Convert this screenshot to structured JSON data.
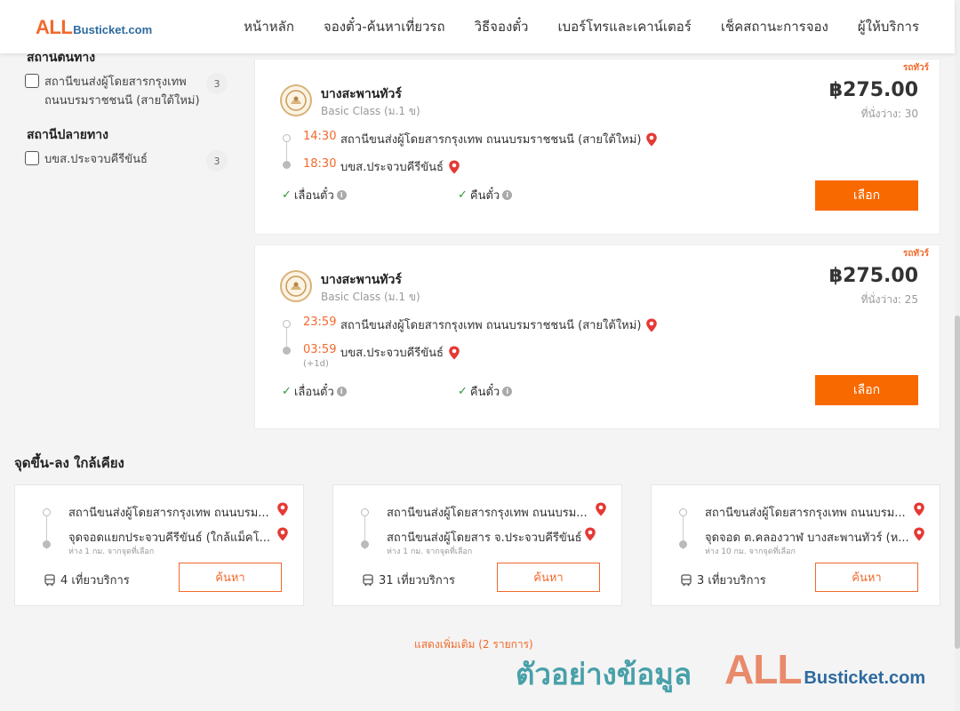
{
  "brand": {
    "logo_all": "ALL",
    "logo_rest": "Busticket.com"
  },
  "nav": [
    "หน้าหลัก",
    "จองตั๋ว-ค้นหาเที่ยวรถ",
    "วิธีจองตั๋ว",
    "เบอร์โทรและเคาน์เตอร์",
    "เช็คสถานะการจอง",
    "ผู้ให้บริการ"
  ],
  "filters": {
    "origin_heading": "สถานีต้นทาง",
    "origin_option": "สถานีขนส่งผู้โดยสารกรุงเทพ ถนนบรมราชชนนี (สายใต้ใหม่)",
    "origin_count": "3",
    "dest_heading": "สถานีปลายทาง",
    "dest_option": "บขส.ประจวบคีรีขันธ์",
    "dest_count": "3"
  },
  "trips": [
    {
      "tag": "รถทัวร์",
      "operator": "บางสะพานทัวร์",
      "class": "Basic Class (ม.1 ข)",
      "price": "฿275.00",
      "seats": "ที่นั่งว่าง: 30",
      "dep_time": "14:30",
      "dep_station": "สถานีขนส่งผู้โดยสารกรุงเทพ ถนนบรมราชชนนี (สายใต้ใหม่)",
      "arr_time": "18:30",
      "arr_station": "บขส.ประจวบคีรีขันธ์",
      "plus_day": "",
      "feature_1": "เลื่อนตั๋ว",
      "feature_2": "คืนตั๋ว",
      "select_label": "เลือก"
    },
    {
      "tag": "รถทัวร์",
      "operator": "บางสะพานทัวร์",
      "class": "Basic Class (ม.1 ข)",
      "price": "฿275.00",
      "seats": "ที่นั่งว่าง: 25",
      "dep_time": "23:59",
      "dep_station": "สถานีขนส่งผู้โดยสารกรุงเทพ ถนนบรมราชชนนี (สายใต้ใหม่)",
      "arr_time": "03:59",
      "arr_station": "บขส.ประจวบคีรีขันธ์",
      "plus_day": "(+1d)",
      "feature_1": "เลื่อนตั๋ว",
      "feature_2": "คืนตั๋ว",
      "select_label": "เลือก"
    }
  ],
  "nearby": {
    "title": "จุดขึ้น-ลง ใกล้เคียง",
    "cards": [
      {
        "from": "สถานีขนส่งผู้โดยสารกรุงเทพ ถนนบรม...",
        "to": "จุดจอดแยกประจวบคีรีขันธ์ (ใกล้แม็คโ...",
        "distance": "ห่าง 1 กม. จากจุดที่เลือก",
        "trips": "4 เที่ยวบริการ",
        "button": "ค้นหา"
      },
      {
        "from": "สถานีขนส่งผู้โดยสารกรุงเทพ ถนนบรม...",
        "to": "สถานีขนส่งผู้โดยสาร จ.ประจวบคีรีขันธ์",
        "distance": "ห่าง 1 กม. จากจุดที่เลือก",
        "trips": "31 เที่ยวบริการ",
        "button": "ค้นหา"
      },
      {
        "from": "สถานีขนส่งผู้โดยสารกรุงเทพ ถนนบรม...",
        "to": "จุดจอด ต.คลองวาฬ บางสะพานทัวร์ (ห...",
        "distance": "ห่าง 10 กม. จากจุดที่เลือก",
        "trips": "3 เที่ยวบริการ",
        "button": "ค้นหา"
      }
    ],
    "show_more": "แสดงเพิ่มเติม (2 รายการ)"
  },
  "watermark": {
    "text": "ตัวอย่างข้อมูล",
    "logo_all": "ALL",
    "logo_rest": "Busticket.com"
  },
  "colors": {
    "accent": "#f86900",
    "brand_orange": "#f2692c",
    "brand_blue": "#2d6a9f",
    "check_green": "#2c9a3c"
  }
}
